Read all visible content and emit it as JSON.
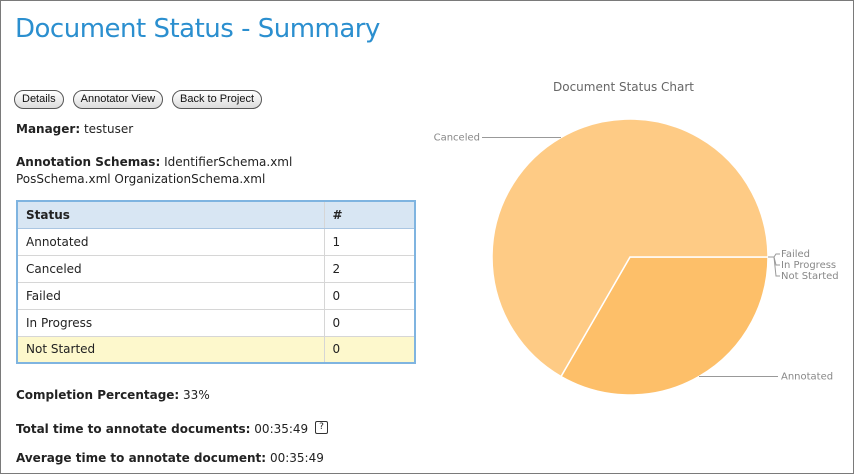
{
  "page": {
    "title": "Document Status - Summary"
  },
  "buttons": {
    "details": "Details",
    "annotator_view": "Annotator View",
    "back_to_project": "Back to Project"
  },
  "manager": {
    "label": "Manager:",
    "value": "testuser"
  },
  "schemas": {
    "label": "Annotation Schemas:",
    "line1": "IdentifierSchema.xml",
    "line2": "PosSchema.xml OrganizationSchema.xml"
  },
  "status_table": {
    "headers": [
      "Status",
      "#"
    ],
    "rows": [
      {
        "status": "Annotated",
        "count": "1"
      },
      {
        "status": "Canceled",
        "count": "2"
      },
      {
        "status": "Failed",
        "count": "0"
      },
      {
        "status": "In Progress",
        "count": "0"
      },
      {
        "status": "Not Started",
        "count": "0"
      }
    ]
  },
  "metrics": {
    "completion_label": "Completion Percentage:",
    "completion_value": "33%",
    "total_time_label": "Total time to annotate documents:",
    "total_time_value": "00:35:49",
    "avg_time_label": "Average time to annotate document:",
    "avg_time_value": "00:35:49"
  },
  "icons": {
    "help": "question-icon"
  },
  "colors": {
    "title": "#2b8fcf",
    "table_border": "#7fb4e0",
    "table_header_bg": "#d8e6f3",
    "highlight_row": "#fdf8cc",
    "canceled_slice": "#fecb85",
    "annotated_slice": "#fdbf69"
  },
  "chart_data": {
    "type": "pie",
    "title": "Document Status Chart",
    "slices": [
      {
        "label": "Annotated",
        "value": 1,
        "color": "#fdbf69"
      },
      {
        "label": "Canceled",
        "value": 2,
        "color": "#fecb85"
      },
      {
        "label": "Failed",
        "value": 0,
        "color": "#fecb85"
      },
      {
        "label": "In Progress",
        "value": 0,
        "color": "#fecb85"
      },
      {
        "label": "Not Started",
        "value": 0,
        "color": "#fecb85"
      }
    ]
  }
}
